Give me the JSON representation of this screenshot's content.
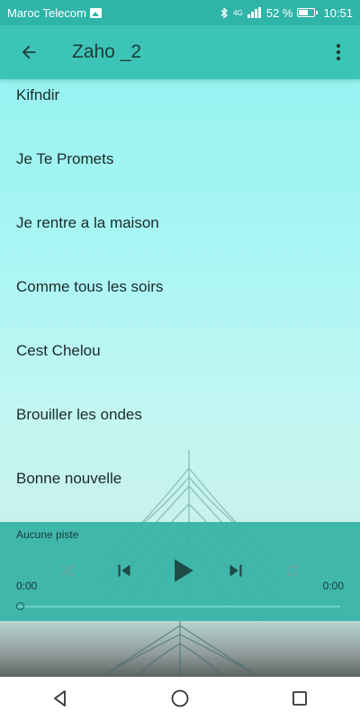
{
  "status_bar": {
    "carrier": "Maroc Telecom",
    "network": "4G",
    "battery": "52 %",
    "time": "10:51"
  },
  "app_bar": {
    "title": "Zaho _2"
  },
  "songs": [
    "Kifndir",
    "Je Te Promets",
    "Je rentre a la maison",
    "Comme tous les soirs",
    "Cest Chelou",
    "Brouiller les ondes",
    "Bonne nouvelle"
  ],
  "player": {
    "track": "Aucune piste",
    "elapsed": "0:00",
    "duration": "0:00",
    "progress": 0
  },
  "colors": {
    "status_bar": "#2fb5a8",
    "app_bar": "#3cc5b6",
    "player": "#34b2a5"
  }
}
